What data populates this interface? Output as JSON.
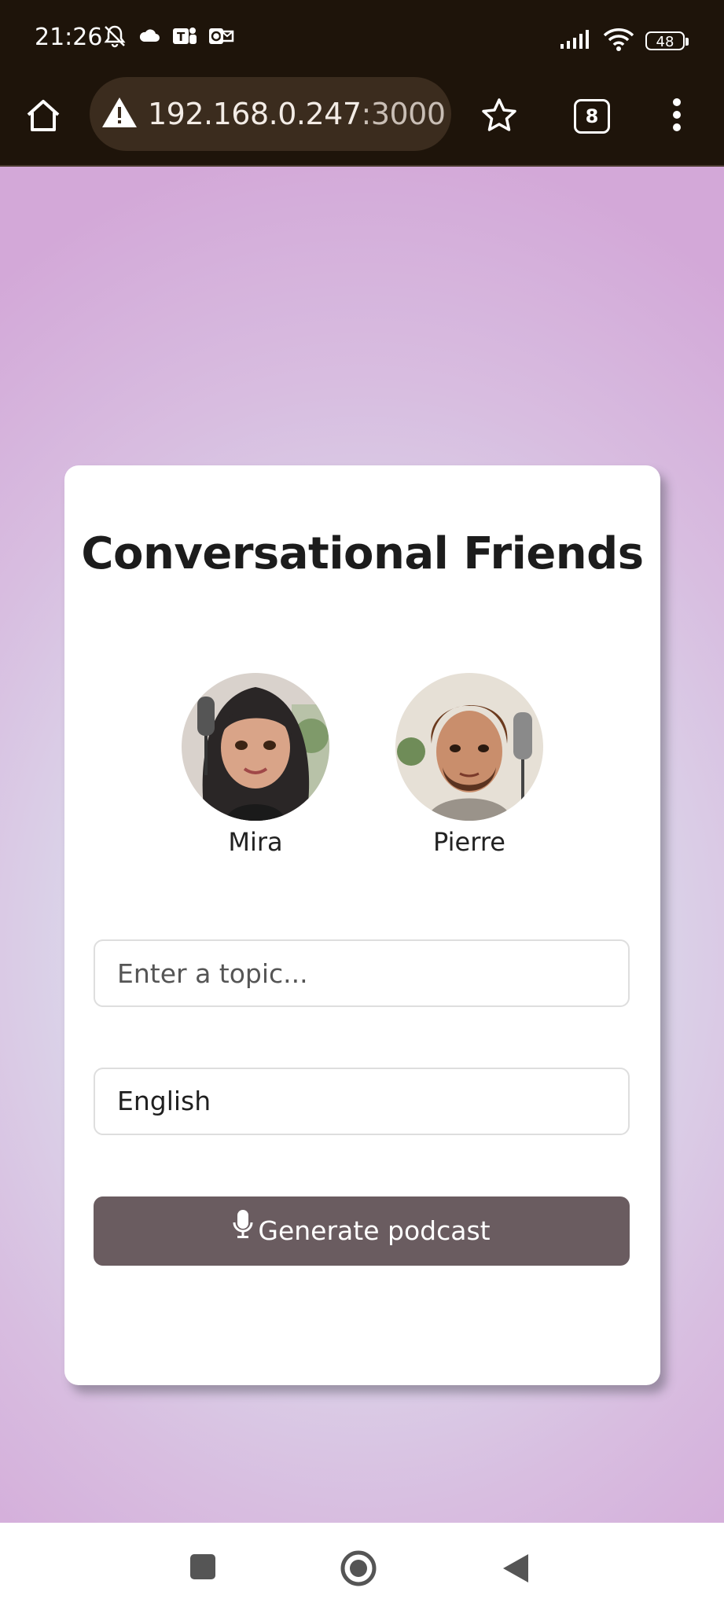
{
  "status_bar": {
    "time": "21:26",
    "battery": "48"
  },
  "browser": {
    "url_host": "192.168.0.247",
    "url_port": ":3000",
    "tab_count": "8"
  },
  "card": {
    "title": "Conversational Friends",
    "hosts": [
      {
        "name": "Mira"
      },
      {
        "name": "Pierre"
      }
    ],
    "topic_placeholder": "Enter a topic...",
    "language_value": "English",
    "generate_label": "Generate podcast"
  },
  "colors": {
    "button_bg": "#6a5c60",
    "browser_bar": "#1e140a",
    "page_gradient_edge": "#d3a8d8",
    "page_gradient_center": "#e5f2f2"
  },
  "icons": [
    "home-icon",
    "warning-icon",
    "star-icon",
    "tabs-icon",
    "more-vert-icon",
    "mic-icon",
    "recents-icon",
    "home-nav-icon",
    "back-icon",
    "muted-bell-icon",
    "cloud-icon",
    "teams-icon",
    "outlook-icon",
    "signal-icon",
    "wifi-icon"
  ]
}
